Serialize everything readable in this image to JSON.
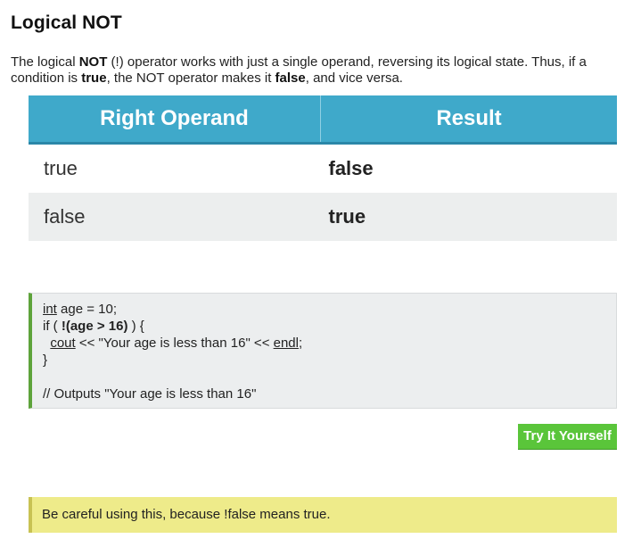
{
  "title": "Logical NOT",
  "intro": {
    "p1": "The logical ",
    "b1": "NOT",
    "p2": " (!) operator works with just a single operand, reversing its logical state. Thus, if a condition is ",
    "b2": "true",
    "p3": ", the NOT operator makes it ",
    "b3": "false",
    "p4": ", and vice versa."
  },
  "table": {
    "headers": [
      "Right Operand",
      "Result"
    ],
    "rows": [
      [
        "true",
        "false"
      ],
      [
        "false",
        "true"
      ]
    ],
    "colors": {
      "header_bg": "#3fa9ca",
      "row_alt_bg": "#eceeee"
    }
  },
  "code": {
    "line1": {
      "kw": "int",
      "rest": " age = 10;"
    },
    "line2": {
      "pre": "if ( ",
      "bold": "!(age > 16)",
      "post": " ) {"
    },
    "line3": {
      "indent": "  ",
      "kw1": "cout",
      "mid": " << \"Your age is less than 16\" << ",
      "kw2": "endl",
      "end": ";"
    },
    "line4": "}",
    "line5": "",
    "line6": "// Outputs \"Your age is less than 16\""
  },
  "try_button": {
    "label": "Try It Yourself",
    "color": "#5ac53a"
  },
  "note": {
    "text": "Be careful using this, because !false means true.",
    "color": "#eeeb8a"
  }
}
